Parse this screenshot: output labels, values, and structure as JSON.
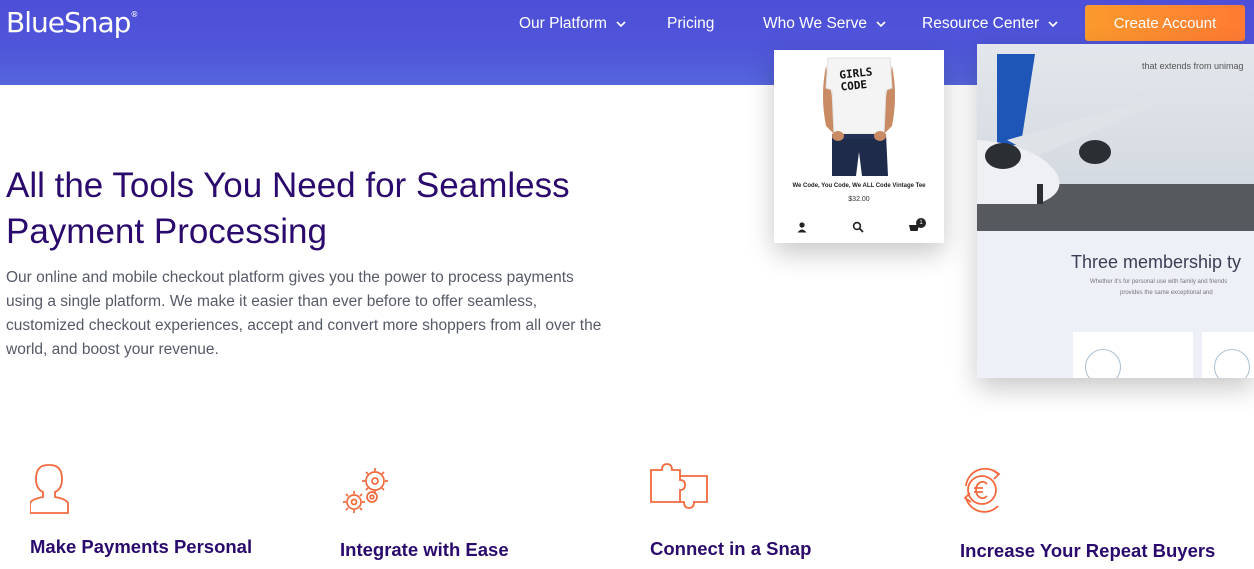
{
  "header": {
    "logo": "BlueSnap",
    "logo_mark": "®",
    "nav": [
      {
        "label": "Our Platform",
        "has_dropdown": true
      },
      {
        "label": "Pricing",
        "has_dropdown": false
      },
      {
        "label": "Who We Serve",
        "has_dropdown": true
      },
      {
        "label": "Resource Center",
        "has_dropdown": true
      }
    ],
    "cta_label": "Create Account"
  },
  "hero": {
    "title_line1": "All the Tools You Need for Seamless",
    "title_line2": "Payment Processing",
    "description": "Our online and mobile checkout platform gives you the power to process payments using a single platform. We make it easier than ever before to offer seamless, customized checkout experiences, accept and convert more shoppers from all over the world, and boost your revenue."
  },
  "product_card": {
    "shirt_text_line1": "GIRLS",
    "shirt_text_line2": "CODE",
    "name": "We Code, You Code, We ALL Code Vintage Tee",
    "price": "$32.00",
    "cart_count": "1"
  },
  "preview": {
    "tagline": "that extends from unimag",
    "membership_title": "Three membership ty",
    "membership_sub1": "Whether it's for personal use with family and friends",
    "membership_sub2": "provides the same exceptional and"
  },
  "features": [
    {
      "title": "Make Payments Personal",
      "icon": "person-icon"
    },
    {
      "title": "Integrate with Ease",
      "icon": "gears-icon"
    },
    {
      "title": "Connect in a Snap",
      "icon": "puzzle-icon"
    },
    {
      "title": "Increase Your Repeat Buyers",
      "icon": "euro-refresh-icon"
    }
  ],
  "colors": {
    "header_bg": "#4e4fd8",
    "cta_bg": "#ff8a30",
    "heading": "#2a0a6c",
    "body_text": "#555a66",
    "icon_accent": "#f26a3f"
  }
}
